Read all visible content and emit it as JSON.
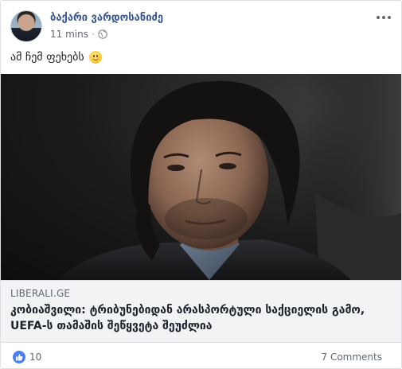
{
  "post": {
    "author": "ბაქარი ვარდოსანიძე",
    "time": "11 mins",
    "separator": "·",
    "privacy_icon": "globe-icon",
    "text": "ამ ჩემ ფეხებს",
    "emoji": "smiley-emoji"
  },
  "link": {
    "domain": "LIBERALI.GE",
    "headline": "კობიაშვილი: ტრიბუნებიდან არასპორტული საქციელის გამო, UEFA-ს თამაშის შეწყვეტა შეუძლია"
  },
  "engagement": {
    "likes": "10",
    "comments": "7 Comments"
  },
  "colors": {
    "author": "#385898",
    "like": "#4b7cf0",
    "secondary_text": "#606770",
    "footer_bg": "#f2f3f5"
  }
}
